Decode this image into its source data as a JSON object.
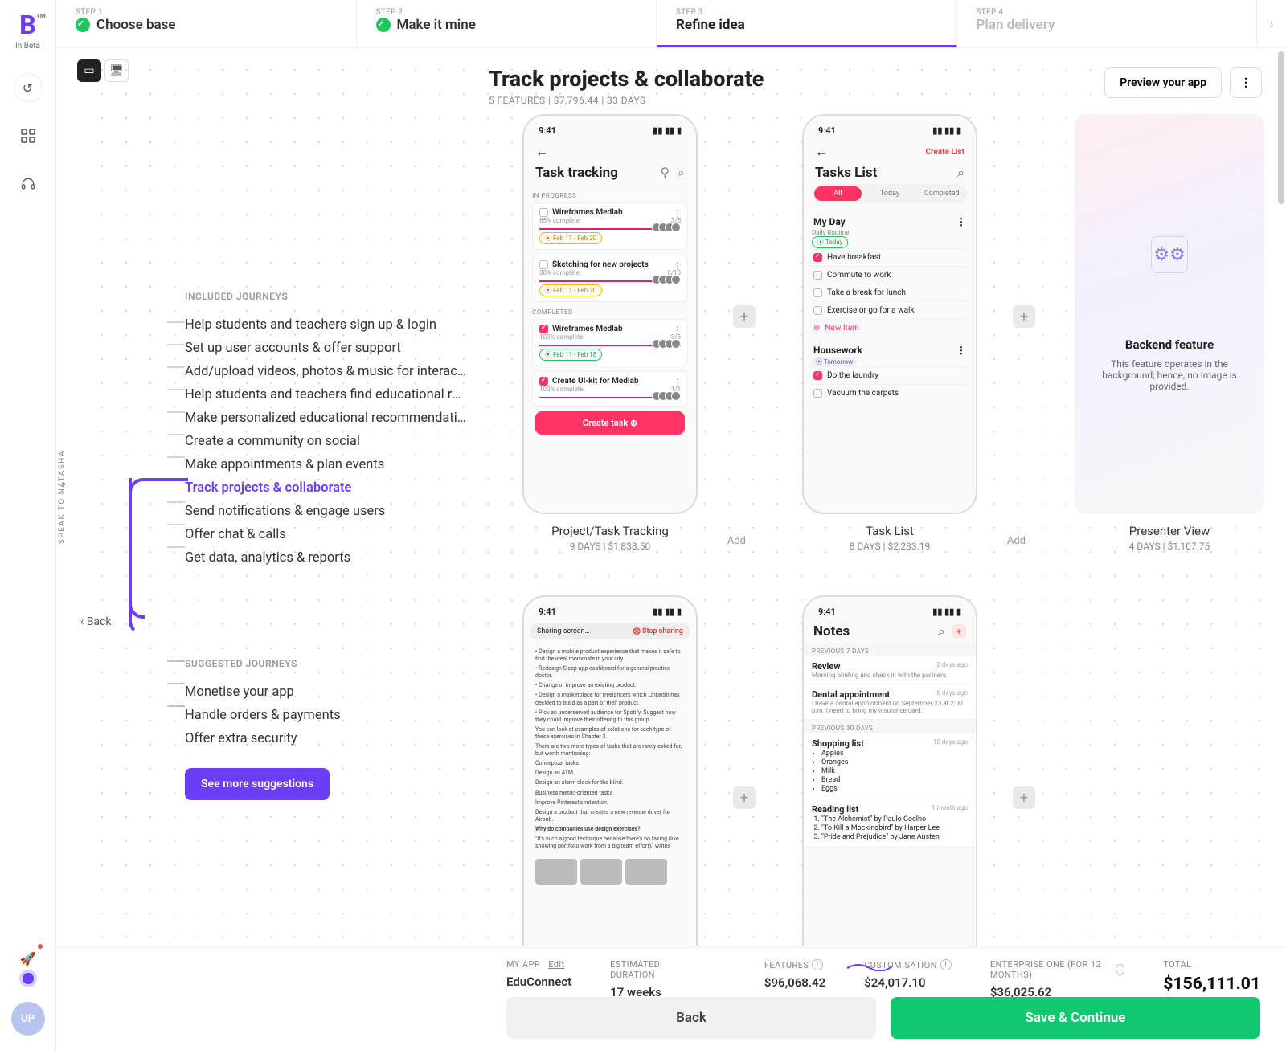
{
  "app": {
    "logo_label": "B",
    "tm": "TM",
    "beta": "In Beta",
    "avatar": "UP",
    "speak_to": "SPEAK TO NATASHA"
  },
  "steps": [
    {
      "n": "STEP 1",
      "t": "Choose base",
      "state": "done"
    },
    {
      "n": "STEP 2",
      "t": "Make it mine",
      "state": "done"
    },
    {
      "n": "STEP 3",
      "t": "Refine idea",
      "state": "active"
    },
    {
      "n": "STEP 4",
      "t": "Plan delivery",
      "state": "disabled"
    }
  ],
  "header": {
    "title": "Track projects & collaborate",
    "subtitle": "5 FEATURES  |  $7,796.44  |  33 DAYS",
    "preview": "Preview your app"
  },
  "journeys_included_label": "INCLUDED JOURNEYS",
  "journeys_included": [
    "Help students and teachers sign up & login",
    "Set up user accounts & offer support",
    "Add/upload videos, photos & music for interactivity",
    "Help students and teachers find educational resources",
    "Make personalized educational recommendations",
    "Create a community on social",
    "Make appointments & plan events",
    "Track projects & collaborate",
    "Send notifications & engage users",
    "Offer chat & calls",
    "Get data, analytics & reports"
  ],
  "journeys_active_index": 7,
  "journeys_suggested_label": "SUGGESTED JOURNEYS",
  "journeys_suggested": [
    "Monetise your app",
    "Handle orders & payments",
    "Offer extra security"
  ],
  "see_more": "See more suggestions",
  "back_link": "Back",
  "cards": [
    {
      "title": "Project/Task Tracking",
      "sub": "9 DAYS | $1,838.50",
      "add": "Add"
    },
    {
      "title": "Task List",
      "sub": "8 DAYS | $2,233.19",
      "add": "Add"
    },
    {
      "title": "Presenter View",
      "sub": "4 DAYS | $1,107.75",
      "add": ""
    }
  ],
  "phone_common": {
    "time": "9:41"
  },
  "phone1": {
    "title": "Task tracking",
    "in_progress": "IN PROGRESS",
    "completed": "COMPLETED",
    "tasks_prog": [
      {
        "name": "Wireframes Medlab",
        "pct": "85% complete",
        "count": "3/5",
        "pill": "Feb 11 - Feb 20",
        "bar": 85
      },
      {
        "name": "Sketching for new projects",
        "pct": "80% complete",
        "count": "8/10",
        "pill": "Feb 11 - Feb 20",
        "bar": 80
      }
    ],
    "tasks_done": [
      {
        "name": "Wireframes Medlab",
        "pct": "100% complete",
        "count": "3/3",
        "pill": "Feb 11 - Feb 18",
        "bar": 100,
        "done": true
      },
      {
        "name": "Create UI-kit for Medlab",
        "pct": "100% complete",
        "count": "1/1",
        "bar": 100,
        "done": true
      }
    ],
    "cta": "Create task  ⊕"
  },
  "phone2": {
    "title": "Tasks List",
    "create": "Create List",
    "tabs": [
      "All",
      "Today",
      "Completed"
    ],
    "myday": "My Day",
    "routine": "Daily Routine",
    "today_pill": "⦿ Today",
    "items": [
      {
        "t": "Have breakfast",
        "on": true
      },
      {
        "t": "Commute to work",
        "on": false
      },
      {
        "t": "Take a break for lunch",
        "on": false
      },
      {
        "t": "Exercise or go for a walk",
        "on": false
      }
    ],
    "new_item": "New Item",
    "housework": "Housework",
    "housework_tag": "⦿ Tomorrow",
    "hitems": [
      {
        "t": "Do the laundry",
        "on": true
      },
      {
        "t": "Vacuum the carpets",
        "on": false
      }
    ]
  },
  "phone3": {
    "sharing": "Sharing screen…",
    "stop": "⨂ Stop sharing",
    "doc_lines": [
      "Design a mobile product experience that makes it safe to find the ideal roommate in your city.",
      "Redesign Sleep app dashboard for a general practice doctor.",
      "Change or improve an existing product.",
      "Design a marketplace for freelancers which LinkedIn has decided to build as a part of their product.",
      "Pick an underserved audience for Spotify. Suggest how they could improve their offering to this group.",
      "You can look at examples of solutions for each type of these exercises in Chapter 3.",
      "There are two more types of tasks that are rarely asked for, but worth mentioning:",
      "Conceptual tasks",
      "Design an ATM.",
      "Design an alarm clock for the blind.",
      "Business metric-oriented tasks",
      "Improve Pinterest's retention.",
      "Design a product that creates a new revenue driver for Airbnb.",
      "Why do companies use design exercises?",
      "\"It's such a good technique because there's no faking (like showing portfolio work from a big team effort),\" writes"
    ]
  },
  "phone4": {
    "title": "Notes",
    "sec7": "PREVIOUS 7 DAYS",
    "sec30": "PREVIOUS 30 DAYS",
    "n1": {
      "t": "Review",
      "d": "Morning briefing and check in with the partners.",
      "when": "2 days ago"
    },
    "n2": {
      "t": "Dental appointment",
      "d": "I have a dental appointment on September 23 at 2:00 p.m. I need to bring my insurance card.",
      "when": "6 days ago"
    },
    "n3": {
      "t": "Shopping list",
      "when": "10 days ago",
      "items": [
        "Apples",
        "Oranges",
        "Milk",
        "Bread",
        "Eggs"
      ]
    },
    "n4": {
      "t": "Reading list",
      "when": "1 month ago",
      "items": [
        "\"The Alchemist\" by Paulo Coelho",
        "\"To Kill a Mockingbird\" by Harper Lee",
        "\"Pride and Prejudice\" by Jane Austen"
      ]
    }
  },
  "backend": {
    "title": "Backend feature",
    "desc": "This feature operates in the background; hence, no image is provided."
  },
  "footer": {
    "myapp_lbl": "MY APP",
    "edit": "Edit",
    "app_name": "EduConnect",
    "dur_lbl": "ESTIMATED DURATION",
    "dur": "17 weeks",
    "feat_lbl": "FEATURES",
    "feat": "$96,068.42",
    "cust_lbl": "CUSTOMISATION",
    "cust": "$24,017.10",
    "ent_lbl": "ENTERPRISE ONE (FOR 12 MONTHS)",
    "ent": "$36,025.62",
    "tot_lbl": "TOTAL",
    "tot": "$156,111.01",
    "back": "Back",
    "save": "Save & Continue"
  }
}
